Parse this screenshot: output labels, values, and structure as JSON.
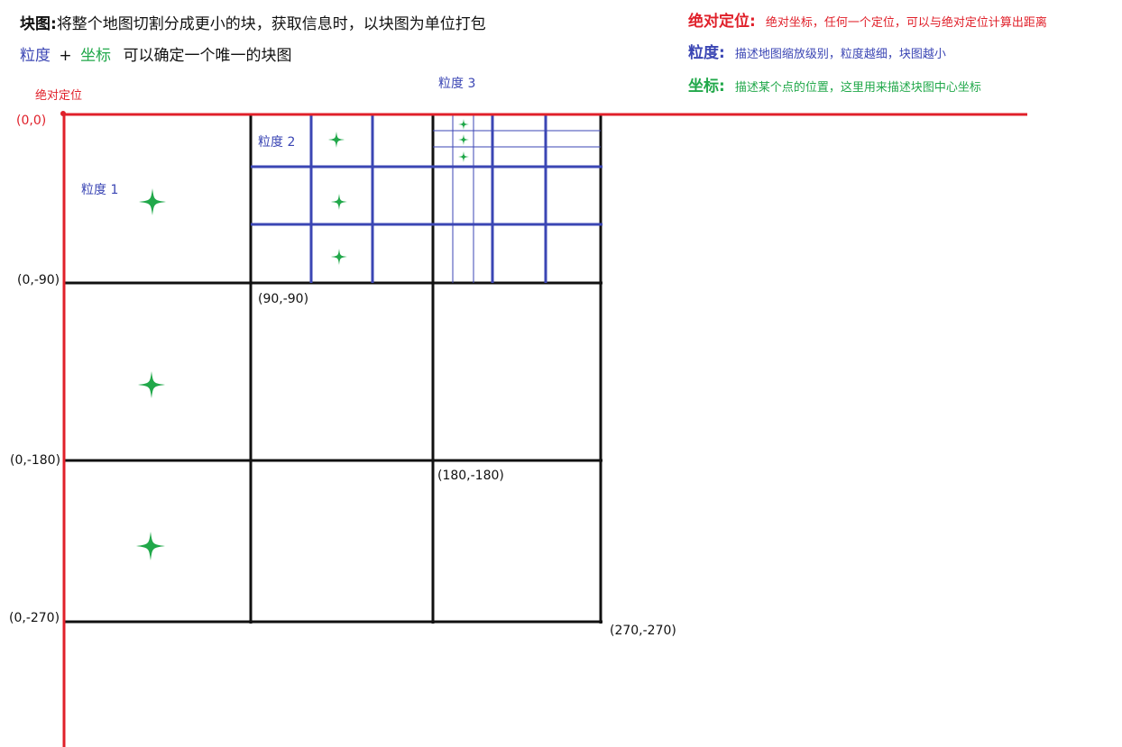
{
  "header": {
    "line1_bold": "块图:",
    "line1_text": "将整个地图切割分成更小的块，获取信息时，以块图为单位打包",
    "line2_granularity": "粒度",
    "line2_plus": "+",
    "line2_coord": "坐标",
    "line2_text": "可以确定一个唯一的块图"
  },
  "legend": {
    "absolute": {
      "title": "绝对定位:",
      "desc": "绝对坐标，任何一个定位，可以与绝对定位计算出距离",
      "color": "#e0202a"
    },
    "granularity": {
      "title": "粒度:",
      "desc": "描述地图缩放级别，粒度越细，块图越小",
      "color": "#3b46b4"
    },
    "coordinate": {
      "title": "坐标:",
      "desc": "描述某个点的位置，这里用来描述块图中心坐标",
      "color": "#21a84a"
    }
  },
  "labels": {
    "absolute_origin": "绝对定位",
    "granularity_1": "粒度 1",
    "granularity_2": "粒度 2",
    "granularity_3": "粒度 3"
  },
  "coordinates": {
    "origin": "(0,0)",
    "y90": "(0,-90)",
    "y180": "(0,-180)",
    "y270": "(0,-270)",
    "p90_90": "(90,-90)",
    "p180_180": "(180,-180)",
    "p270_270": "(270,-270)"
  },
  "colors": {
    "axis": "#e0202a",
    "grid": "#111111",
    "granularity": "#3b46b4",
    "star": "#21a84a"
  }
}
